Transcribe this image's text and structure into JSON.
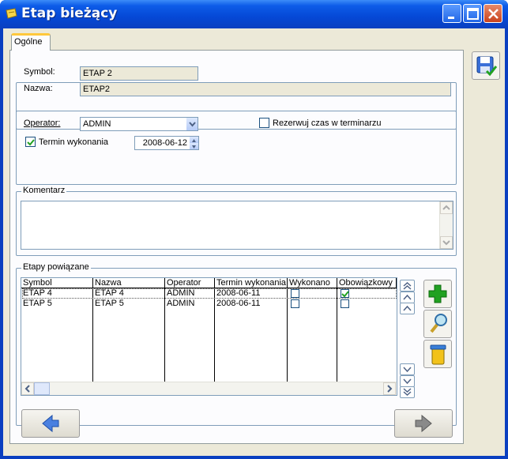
{
  "window": {
    "title": "Etap bieżący"
  },
  "tabs": [
    {
      "label": "Ogólne"
    }
  ],
  "general": {
    "symbol_label": "Symbol:",
    "symbol_value": "ETAP 2",
    "name_label": "Nazwa:",
    "name_value": "ETAP2"
  },
  "operator": {
    "label": "Operator:",
    "value": "ADMIN",
    "reserve_label": "Rezerwuj czas w terminarzu",
    "reserve_checked": false,
    "deadline_label": "Termin wykonania",
    "deadline_checked": true,
    "deadline_value": "2008-06-12"
  },
  "comment": {
    "title": "Komentarz",
    "value": ""
  },
  "related": {
    "title": "Etapy powiązane",
    "columns": [
      "Symbol",
      "Nazwa",
      "Operator",
      "Termin wykonania",
      "Wykonano",
      "Obowiązkowy"
    ],
    "rows": [
      {
        "symbol": "ETAP 4",
        "name": "ETAP 4",
        "operator": "ADMIN",
        "date": "2008-06-11",
        "done": false,
        "mandatory": true
      },
      {
        "symbol": "ETAP 5",
        "name": "ETAP 5",
        "operator": "ADMIN",
        "date": "2008-06-11",
        "done": false,
        "mandatory": false
      }
    ]
  },
  "icons": {
    "save": "save-icon",
    "add": "plus-icon",
    "edit": "magnifier-icon",
    "delete": "trash-icon",
    "back": "arrow-left-icon",
    "forward": "arrow-right-icon"
  },
  "colors": {
    "titlebar": "#0548d6",
    "accent_green": "#21a121",
    "window_bg": "#ece9d8"
  }
}
